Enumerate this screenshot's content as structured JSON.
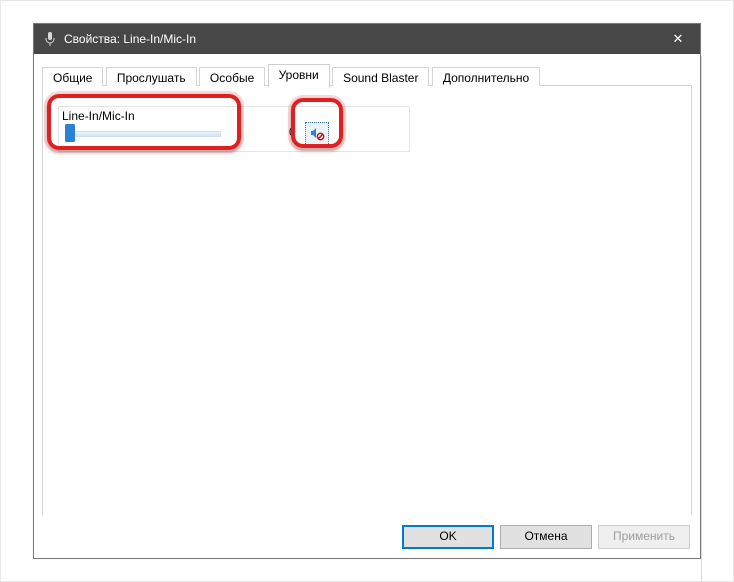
{
  "window": {
    "title": "Свойства: Line-In/Mic-In"
  },
  "tabs": [
    {
      "label": "Общие"
    },
    {
      "label": "Прослушать"
    },
    {
      "label": "Особые"
    },
    {
      "label": "Уровни"
    },
    {
      "label": "Sound Blaster"
    },
    {
      "label": "Дополнительно"
    }
  ],
  "active_tab": "Уровни",
  "levels": {
    "device_name": "Line-In/Mic-In",
    "value": 0,
    "value_text": "0",
    "muted": true,
    "slider_min": 0,
    "slider_max": 100
  },
  "footer": {
    "ok": "OK",
    "cancel": "Отмена",
    "apply": "Применить"
  },
  "icons": {
    "close": "✕"
  },
  "annotation_color": "#e02020"
}
